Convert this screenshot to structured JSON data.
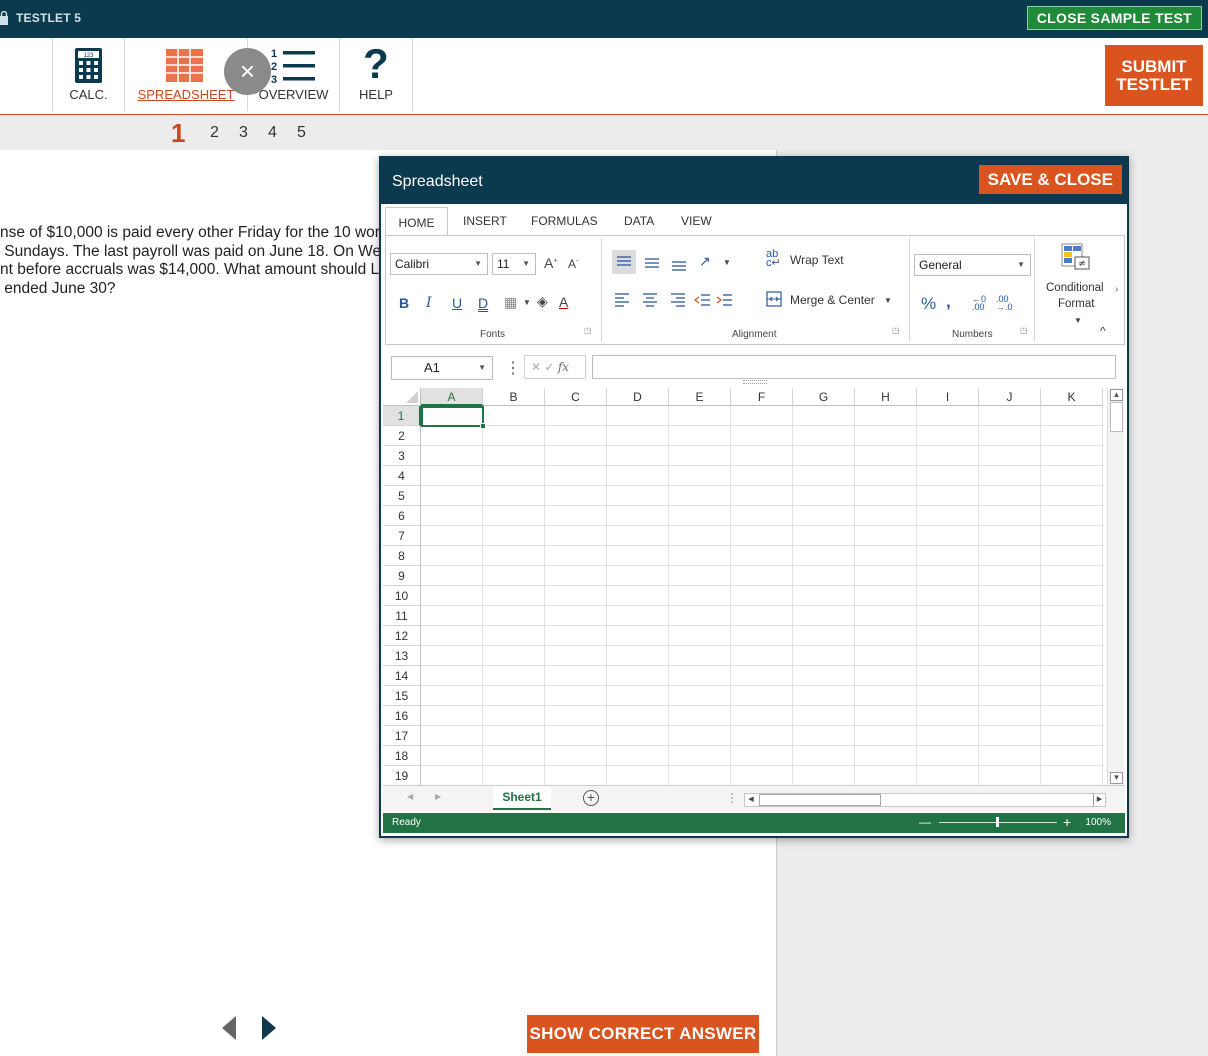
{
  "topbar": {
    "testlet_title": "TESTLET 5",
    "close_sample_label": "CLOSE SAMPLE TEST"
  },
  "toolbar": {
    "calc_label": "CALC.",
    "spreadsheet_label": "SPREADSHEET",
    "overview_label": "OVERVIEW",
    "help_label": "HELP",
    "calc_badge": "123",
    "submit_label": "SUBMIT TESTLET",
    "close_glyph": "×",
    "help_glyph": "?"
  },
  "question_nav": {
    "numbers": [
      "1",
      "2",
      "3",
      "4",
      "5"
    ],
    "active": "1"
  },
  "question": {
    "text": "nse of $10,000 is paid every other Friday for the 10 wor\n Sundays. The last payroll was paid on June 18. On We\nnt before accruals was $14,000. What amount should L\n ended June 30?"
  },
  "bottom": {
    "show_answer_label": "SHOW CORRECT ANSWER"
  },
  "spreadsheet": {
    "title": "Spreadsheet",
    "save_close_label": "SAVE & CLOSE",
    "tabs": [
      "HOME",
      "INSERT",
      "FORMULAS",
      "DATA",
      "VIEW"
    ],
    "active_tab": "HOME",
    "font_name": "Calibri",
    "font_size": "11",
    "number_format": "General",
    "wrap_text_label": "Wrap Text",
    "merge_center_label": "Merge & Center",
    "conditional_format_label_1": "Conditional",
    "conditional_format_label_2": "Format",
    "group_fonts": "Fonts",
    "group_alignment": "Alignment",
    "group_numbers": "Numbers",
    "name_box": "A1",
    "columns": [
      "A",
      "B",
      "C",
      "D",
      "E",
      "F",
      "G",
      "H",
      "I",
      "J",
      "K"
    ],
    "rows": [
      "1",
      "2",
      "3",
      "4",
      "5",
      "6",
      "7",
      "8",
      "9",
      "10",
      "11",
      "12",
      "13",
      "14",
      "15",
      "16",
      "17",
      "18",
      "19"
    ],
    "selected_cell": "A1",
    "sheet_tab": "Sheet1",
    "status": "Ready",
    "zoom": "100%",
    "fx_label": "fx"
  },
  "colors": {
    "navy": "#0b3a4e",
    "orange": "#d9541e",
    "excel_green": "#217346",
    "close_green": "#1e8a3a"
  }
}
